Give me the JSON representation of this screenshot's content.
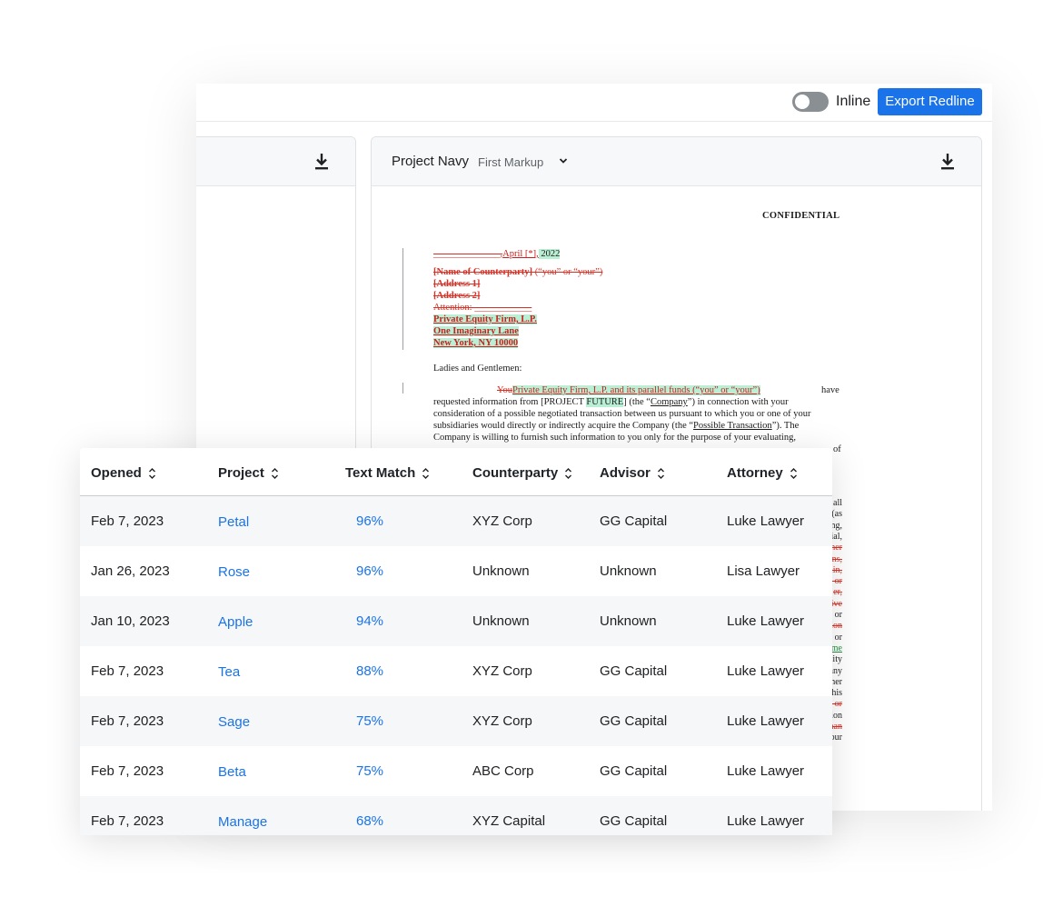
{
  "toolbar": {
    "inline_label": "Inline",
    "export_label": "Export Redline"
  },
  "right_pane": {
    "title": "Project Navy",
    "subtitle": "First Markup"
  },
  "document": {
    "confidential": "CONFIDENTIAL",
    "date_deleted": "______________,",
    "date_inserted": "April [*],",
    "date_year": " 2022",
    "name_deleted": "[Name of Counterparty]",
    "you_deleted": " (“you” or “your”)",
    "address1_deleted": "[Address 1]",
    "address2_deleted": "[Address 2]",
    "attention_deleted": "Attention: ____________",
    "firm_inserted": "Private Equity Firm, L.P.",
    "street_inserted": "One Imaginary Lane",
    "city_inserted": "New York, NY 10000",
    "salutation": "Ladies and Gentlemen:",
    "para_deleted": "You",
    "para_inserted": "Private Equity Firm, L.P. and its parallel funds (“you” or “your”)",
    "para_have": " have",
    "para_line2_a": "requested information from [PROJECT ",
    "para_line2_hl": "FUTURE",
    "para_line2_b": "] (the “",
    "para_company": "Company",
    "para_line2_c": "”) in connection with your",
    "para_line3": "consideration of a possible negotiated transaction between us pursuant to which you or one of your",
    "para_line4_a": "subsidiaries would directly or indirectly acquire the Company (the “",
    "para_possible": "Possible Transaction",
    "para_line4_b": "”).  The",
    "para_line5": "Company is willing to furnish such information to you only for the purpose of your evaluating,",
    "para_line6_tail": "of",
    "edge_fragments": [
      "all",
      "(as",
      "ng,",
      "ial,",
      "her",
      "ns,",
      "ain,",
      "- or",
      "er,",
      "ive",
      "or",
      "ion",
      "or",
      "me",
      "lity",
      "any",
      "her",
      "his",
      "- or",
      "ion",
      "han",
      "our"
    ]
  },
  "table": {
    "headers": [
      "Opened",
      "Project",
      "Text Match",
      "Counterparty",
      "Advisor",
      "Attorney"
    ],
    "rows": [
      {
        "opened": "Feb 7, 2023",
        "project": "Petal",
        "match": "96%",
        "counterparty": "XYZ Corp",
        "advisor": "GG Capital",
        "attorney": "Luke Lawyer"
      },
      {
        "opened": "Jan 26, 2023",
        "project": "Rose",
        "match": "96%",
        "counterparty": "Unknown",
        "advisor": "Unknown",
        "attorney": "Lisa Lawyer"
      },
      {
        "opened": "Jan 10, 2023",
        "project": "Apple",
        "match": "94%",
        "counterparty": "Unknown",
        "advisor": "Unknown",
        "attorney": "Luke Lawyer"
      },
      {
        "opened": "Feb 7, 2023",
        "project": "Tea",
        "match": "88%",
        "counterparty": "XYZ Corp",
        "advisor": "GG Capital",
        "attorney": "Luke Lawyer"
      },
      {
        "opened": "Feb 7, 2023",
        "project": "Sage",
        "match": "75%",
        "counterparty": "XYZ Corp",
        "advisor": "GG Capital",
        "attorney": "Luke Lawyer"
      },
      {
        "opened": "Feb 7, 2023",
        "project": "Beta",
        "match": "75%",
        "counterparty": "ABC Corp",
        "advisor": "GG Capital",
        "attorney": "Luke Lawyer"
      },
      {
        "opened": "Feb 7, 2023",
        "project": "Manage",
        "match": "68%",
        "counterparty": "XYZ Capital",
        "advisor": "GG Capital",
        "attorney": "Luke Lawyer"
      }
    ]
  }
}
